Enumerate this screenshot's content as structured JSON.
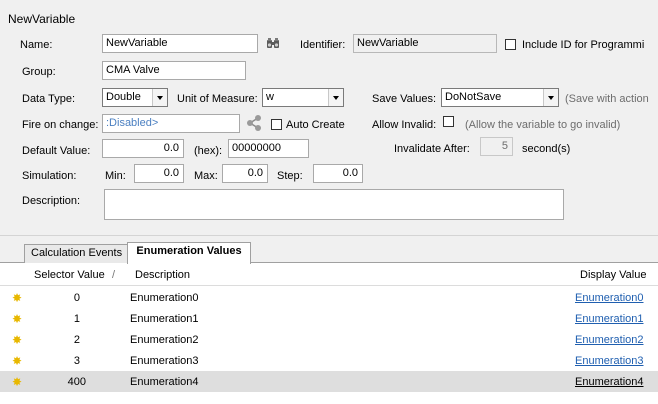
{
  "window_title": "NewVariable",
  "form": {
    "name_label": "Name:",
    "name_value": "NewVariable",
    "identifier_label": "Identifier:",
    "identifier_value": "NewVariable",
    "include_id_label": "Include ID for Programmi",
    "group_label": "Group:",
    "group_value": "CMA Valve",
    "data_type_label": "Data Type:",
    "data_type_value": "Double",
    "unit_label": "Unit of Measure:",
    "unit_value": "w",
    "save_values_label": "Save Values:",
    "save_values_value": "DoNotSave",
    "save_hint": "(Save with action",
    "fire_label": "Fire on change:",
    "fire_value": ":Disabled>",
    "auto_create_label": "Auto Create",
    "allow_invalid_label": "Allow Invalid:",
    "allow_invalid_hint": "(Allow the variable to go invalid)",
    "default_label": "Default Value:",
    "default_value": "0.0",
    "hex_label": "(hex):",
    "hex_value": "00000000",
    "invalidate_label": "Invalidate After:",
    "invalidate_value": "5",
    "invalidate_unit": "second(s)",
    "simulation_label": "Simulation:",
    "min_label": "Min:",
    "min_value": "0.0",
    "max_label": "Max:",
    "max_value": "0.0",
    "step_label": "Step:",
    "step_value": "0.0",
    "description_label": "Description:",
    "description_value": ""
  },
  "tabs": [
    {
      "label": "Calculation Events",
      "active": false
    },
    {
      "label": "Enumeration Values",
      "active": true
    }
  ],
  "grid": {
    "headers": {
      "selector": "Selector Value",
      "sort_glyph": "/",
      "description": "Description",
      "display": "Display Value"
    },
    "rows": [
      {
        "selector": "0",
        "description": "Enumeration0",
        "display": "Enumeration0"
      },
      {
        "selector": "1",
        "description": "Enumeration1",
        "display": "Enumeration1"
      },
      {
        "selector": "2",
        "description": "Enumeration2",
        "display": "Enumeration2"
      },
      {
        "selector": "3",
        "description": "Enumeration3",
        "display": "Enumeration3"
      },
      {
        "selector": "400",
        "description": "Enumeration4",
        "display": "Enumeration4"
      }
    ]
  },
  "icons": {
    "lookup": "binoculars-icon",
    "link": "share-icon",
    "row": "star-icon"
  },
  "colors": {
    "panel": "#f0f0f0",
    "link": "#1f5fb0",
    "selected_row": "#dedede",
    "row_icon": "#e8b800"
  }
}
